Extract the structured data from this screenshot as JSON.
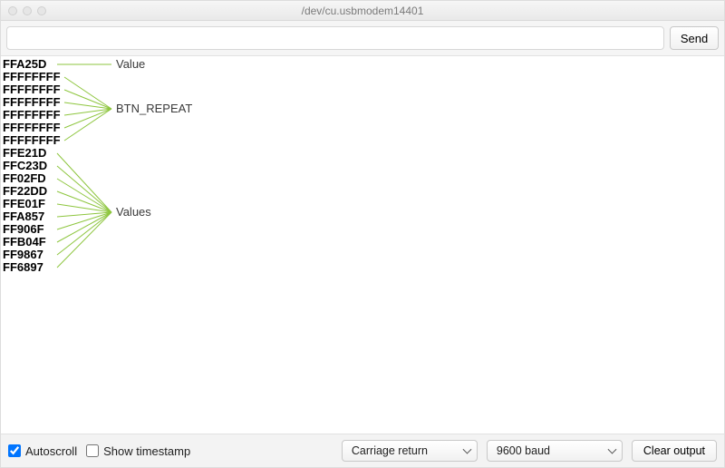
{
  "title": "/dev/cu.usbmodem14401",
  "input": {
    "value": "",
    "placeholder": ""
  },
  "send_label": "Send",
  "lines": [
    "FFA25D",
    "FFFFFFFF",
    "FFFFFFFF",
    "FFFFFFFF",
    "FFFFFFFF",
    "FFFFFFFF",
    "FFFFFFFF",
    "FFE21D",
    "FFC23D",
    "FF02FD",
    "FF22DD",
    "FFE01F",
    "FFA857",
    "FF906F",
    "FFB04F",
    "FF9867",
    "FF6897"
  ],
  "annotations": {
    "value": "Value",
    "btn_repeat": "BTN_REPEAT",
    "values": "Values"
  },
  "bottom": {
    "autoscroll_label": "Autoscroll",
    "autoscroll_checked": true,
    "timestamp_label": "Show timestamp",
    "timestamp_checked": false,
    "line_ending_selected": "Carriage return",
    "baud_selected": "9600 baud",
    "clear_label": "Clear output"
  }
}
